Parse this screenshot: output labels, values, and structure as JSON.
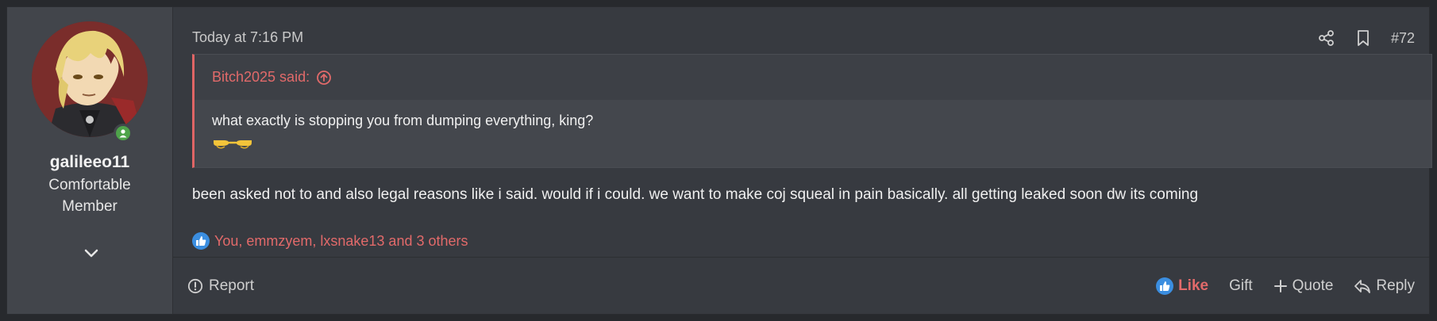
{
  "user": {
    "name": "galileeo11",
    "title": "Comfortable Member",
    "avatar_icon": "avatar-image",
    "online_icon": "online-status-icon",
    "expand_icon": "chevron-down-icon"
  },
  "post": {
    "timestamp": "Today at 7:16 PM",
    "number": "#72",
    "share_icon": "share-icon",
    "bookmark_icon": "bookmark-icon",
    "quote": {
      "author_said": "Bitch2025 said:",
      "jump_icon": "arrow-up-circle-icon",
      "text": "what exactly is stopping you from dumping everything, king?",
      "emoji": "pointing-hands-emoji"
    },
    "message": "been asked not to and also legal reasons like i said. would if i could. we want to make coj squeal in pain basically. all getting leaked soon dw its coming"
  },
  "reactions": {
    "icon": "thumbs-up-icon",
    "text": "You, emmzyem, lxsnake13 and 3 others"
  },
  "footer": {
    "report": "Report",
    "like": "Like",
    "gift": "Gift",
    "quote": "Quote",
    "reply": "Reply"
  },
  "colors": {
    "accent": "#e26a6a",
    "like_blue": "#3b8ee0",
    "online_green": "#4ea34a",
    "background": "#373a40"
  }
}
